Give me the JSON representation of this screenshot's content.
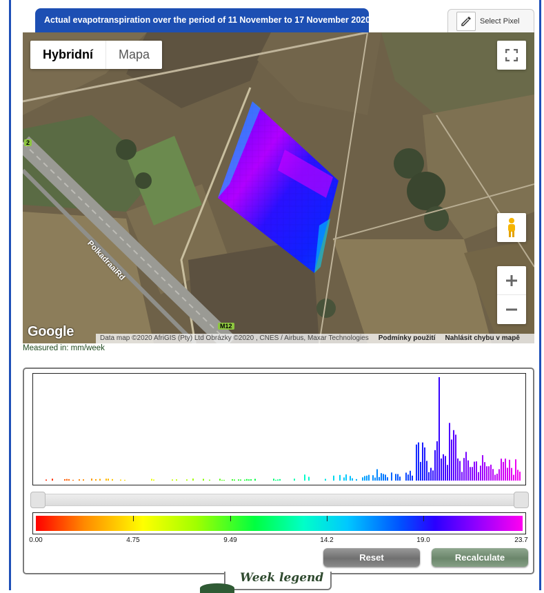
{
  "header": {
    "title": "Actual evapotranspiration over the period of 11 November to 17 November 2020",
    "select_pixel_label": "Select Pixel"
  },
  "map": {
    "map_type_tabs": [
      "Hybridní",
      "Mapa"
    ],
    "active_map_type": "Hybridní",
    "road_label": "PolkadraaiRd",
    "route_shields": [
      "2",
      "M12"
    ],
    "google_logo": "Google",
    "attribution": "Data map ©2020 AfriGIS (Pty) Ltd Obrázky ©2020 , CNES / Airbus, Maxar Technologies",
    "terms_link": "Podmínky použití",
    "report_link": "Nahlásit chybu v mapě",
    "controls": [
      "fullscreen-icon",
      "pegman-icon",
      "zoom-in-icon",
      "zoom-out-icon"
    ]
  },
  "measured_in": "Measured in: mm/week",
  "histogram": {
    "legend_ticks": [
      "0.00",
      "4.75",
      "9.49",
      "14.2",
      "19.0",
      "23.7"
    ],
    "range_min": 0,
    "range_max": 23.7,
    "reset_label": "Reset",
    "recalculate_label": "Recalculate"
  },
  "footer": {
    "week_legend_label": "Week legend"
  },
  "colors": {
    "header_blue": "#1d4fb3",
    "reset_gray": "#7a7a7a",
    "recalc_green": "#6b866b"
  }
}
